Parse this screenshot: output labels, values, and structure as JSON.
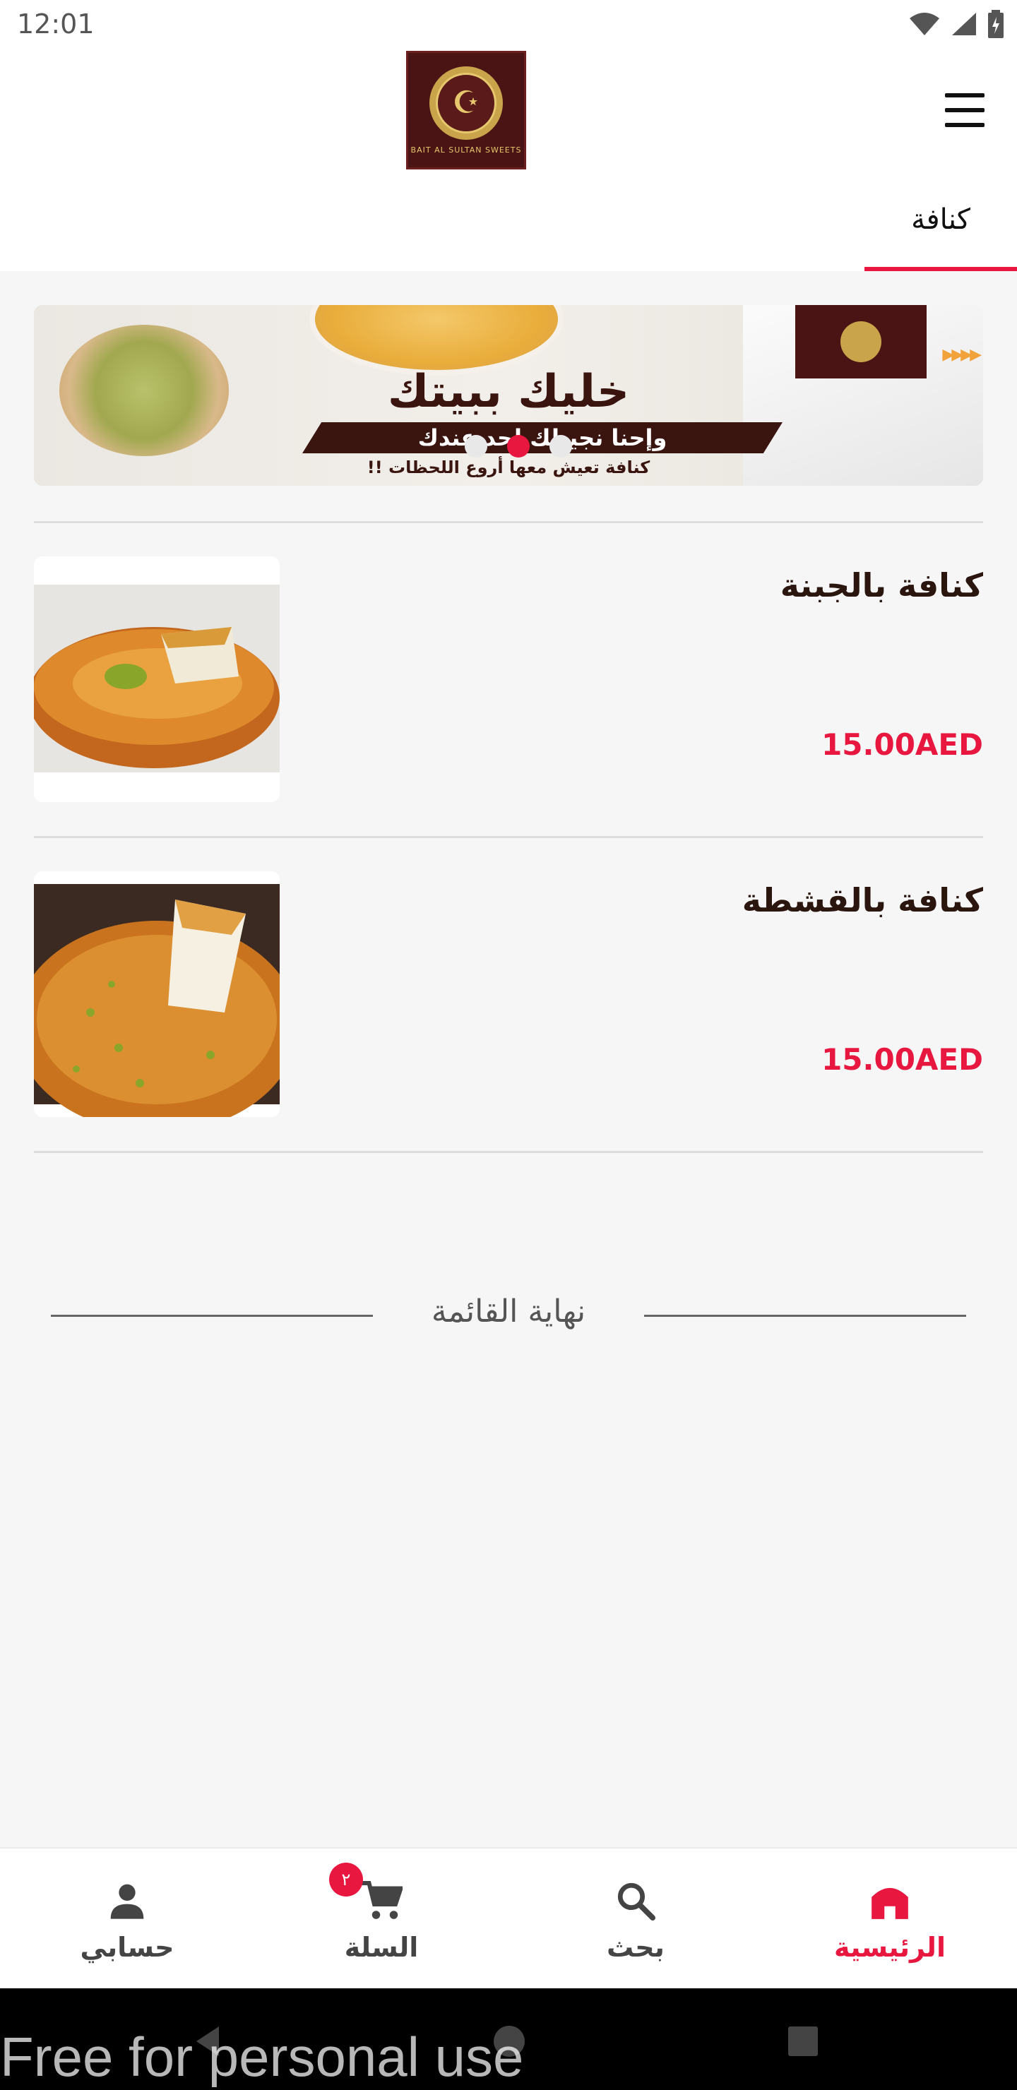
{
  "status_bar": {
    "time": "12:01"
  },
  "header": {
    "tab": "كنافة"
  },
  "banner": {
    "headline": "خليك ببيتك",
    "subline": "وإحنا نجيبلك لحد عندك",
    "caption": "كنافة تعيش معها أروع اللحظات !!",
    "active_slide": 2,
    "slide_count": 3
  },
  "products": [
    {
      "name": "كنافة بالجبنة",
      "price": "15.00AED"
    },
    {
      "name": "كنافة بالقشطة",
      "price": "15.00AED"
    }
  ],
  "end_of_list": "نهاية القائمة",
  "bottom_nav": {
    "account": "حسابي",
    "cart": "السلة",
    "cart_badge": "٢",
    "search": "بحث",
    "home": "الرئيسية",
    "active": "home"
  },
  "watermark": "Free for personal use",
  "colors": {
    "accent": "#e8173f",
    "brand": "#4a1414"
  }
}
